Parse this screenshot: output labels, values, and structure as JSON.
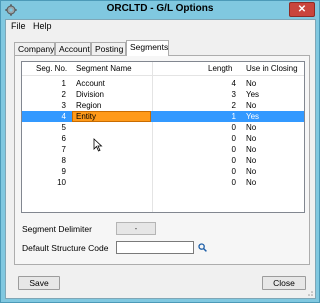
{
  "window": {
    "title": "ORCLTD - G/L Options",
    "close_glyph": "✕"
  },
  "menu": {
    "items": [
      "File",
      "Help"
    ]
  },
  "tabs": [
    {
      "label": "Company",
      "active": false
    },
    {
      "label": "Account",
      "active": false
    },
    {
      "label": "Posting",
      "active": false
    },
    {
      "label": "Segments",
      "active": true
    }
  ],
  "grid": {
    "columns": [
      "Seg. No.",
      "Segment Name",
      "Length",
      "Use in Closing"
    ],
    "rows": [
      {
        "seg_no": "1",
        "name": "Account",
        "length": "4",
        "use_in_closing": "No"
      },
      {
        "seg_no": "2",
        "name": "Division",
        "length": "3",
        "use_in_closing": "Yes"
      },
      {
        "seg_no": "3",
        "name": "Region",
        "length": "2",
        "use_in_closing": "No"
      },
      {
        "seg_no": "4",
        "name": "Entity",
        "length": "1",
        "use_in_closing": "Yes",
        "selected": true,
        "editing": true
      },
      {
        "seg_no": "5",
        "name": "",
        "length": "0",
        "use_in_closing": "No"
      },
      {
        "seg_no": "6",
        "name": "",
        "length": "0",
        "use_in_closing": "No"
      },
      {
        "seg_no": "7",
        "name": "",
        "length": "0",
        "use_in_closing": "No"
      },
      {
        "seg_no": "8",
        "name": "",
        "length": "0",
        "use_in_closing": "No"
      },
      {
        "seg_no": "9",
        "name": "",
        "length": "0",
        "use_in_closing": "No"
      },
      {
        "seg_no": "10",
        "name": "",
        "length": "0",
        "use_in_closing": "No"
      }
    ]
  },
  "fields": {
    "segment_delimiter_label": "Segment Delimiter",
    "segment_delimiter_value": "-",
    "default_structure_code_label": "Default Structure Code",
    "default_structure_code_value": ""
  },
  "buttons": {
    "save": "Save",
    "close": "Close"
  },
  "icons": {
    "app": "gear-icon",
    "finder": "magnifier-icon",
    "cursor": "pointer-cursor-icon"
  },
  "colors": {
    "title_bar": "#80c8e0",
    "selection": "#3399ff",
    "editing_cell": "#ff9a1a",
    "close_button": "#c9453c"
  }
}
